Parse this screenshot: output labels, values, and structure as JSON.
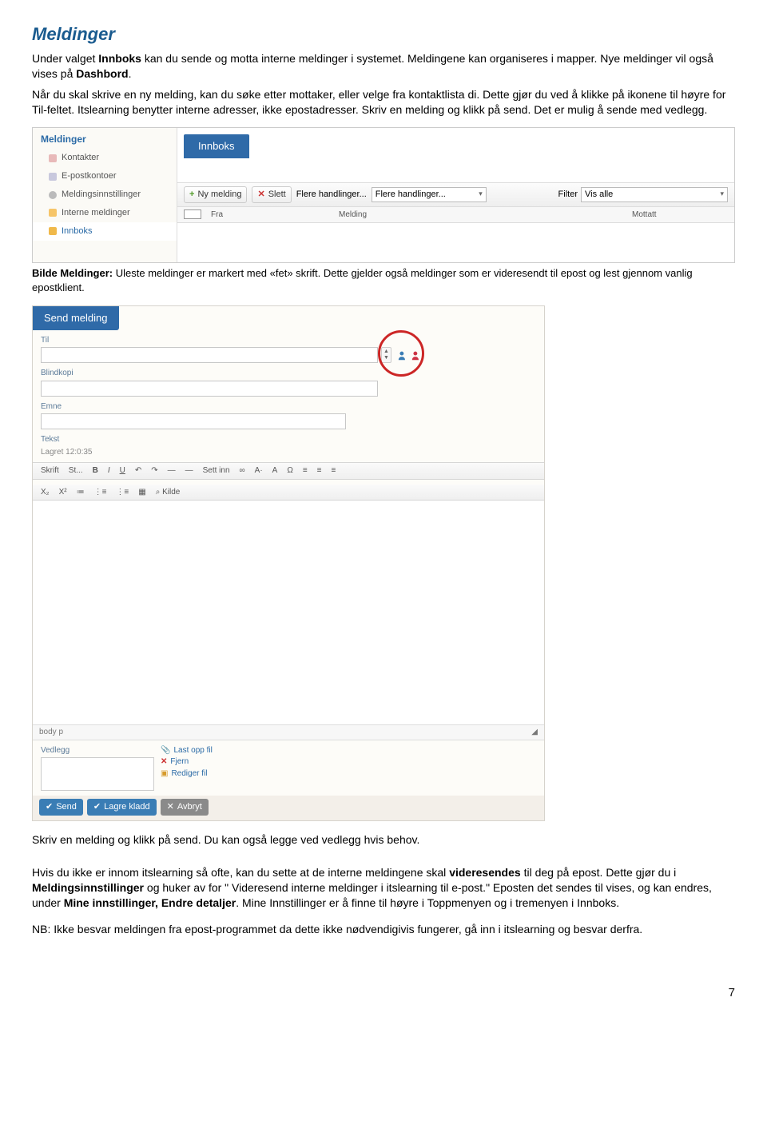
{
  "page": {
    "number": "7"
  },
  "heading": "Meldinger",
  "intro": {
    "p1a": "Under valget ",
    "p1b": "Innboks",
    "p1c": " kan du sende og motta interne meldinger i systemet. Meldingene kan organiseres i mapper. Nye meldinger vil også vises på ",
    "p1d": "Dashbord",
    "p1e": ".",
    "p2": "Når du skal skrive en ny melding, kan du søke etter mottaker, eller velge fra kontaktlista di. Dette gjør du ved å klikke på ikonene til høyre for Til-feltet. Itslearning benytter interne adresser, ikke epostadresser. Skriv en melding og klikk på send. Det er mulig å sende med vedlegg."
  },
  "shot1": {
    "sidebar": {
      "title": "Meldinger",
      "items": [
        "Kontakter",
        "E-postkontoer",
        "Meldingsinnstillinger",
        "Interne meldinger",
        "Innboks"
      ]
    },
    "tab": "Innboks",
    "toolbar": {
      "new": "Ny melding",
      "delete": "Slett",
      "more_text": "Flere handlinger...",
      "more_select": "Flere handlinger...",
      "filter_label": "Filter",
      "filter_value": "Vis alle"
    },
    "columns": {
      "fra": "Fra",
      "melding": "Melding",
      "mottatt": "Mottatt"
    }
  },
  "caption1": {
    "lead": "Bilde Meldinger:",
    "rest": " Uleste meldinger er markert med «fet» skrift. Dette gjelder også meldinger som er videresendt til epost og lest gjennom vanlig epostklient."
  },
  "shot2": {
    "title": "Send melding",
    "labels": {
      "til": "Til",
      "blind": "Blindkopi",
      "emne": "Emne",
      "tekst": "Tekst",
      "lagret": "Lagret 12:0:35",
      "vedlegg": "Vedlegg"
    },
    "editor_row1": [
      "Skrift",
      "St...",
      "B",
      "I",
      "U",
      "↶",
      "↷",
      "—",
      "—",
      "Sett inn",
      "∞",
      "A·",
      "A",
      "Ω",
      "≡",
      "≡",
      "≡"
    ],
    "editor_row2": [
      "X₂",
      "X²",
      "≔",
      "⋮≡",
      "⋮≡",
      "▦",
      "⌕ Kilde"
    ],
    "status_path": "body  p",
    "vedlegg_links": {
      "upload": "Last opp fil",
      "remove": "Fjern",
      "edit": "Rediger fil"
    },
    "buttons": {
      "send": "Send",
      "draft": "Lagre kladd",
      "cancel": "Avbryt"
    }
  },
  "after1": "Skriv en melding og klikk på send. Du kan også legge ved vedlegg hvis behov.",
  "after2": {
    "a": "Hvis du ikke er innom itslearning så ofte, kan du sette at de interne meldingene skal ",
    "b": "videresendes",
    "c": " til deg på epost. Dette gjør du i ",
    "d": "Meldingsinnstillinger",
    "e": " og huker av for \" Videresend interne meldinger i itslearning til e-post.\" Eposten det sendes til vises, og kan endres, under ",
    "f": "Mine innstillinger, Endre detaljer",
    "g": ". Mine Innstillinger er å finne til høyre i Toppmenyen og i tremenyen i Innboks."
  },
  "after3": "NB: Ikke besvar meldingen fra epost-programmet da dette ikke nødvendigivis fungerer, gå inn i itslearning og besvar derfra."
}
